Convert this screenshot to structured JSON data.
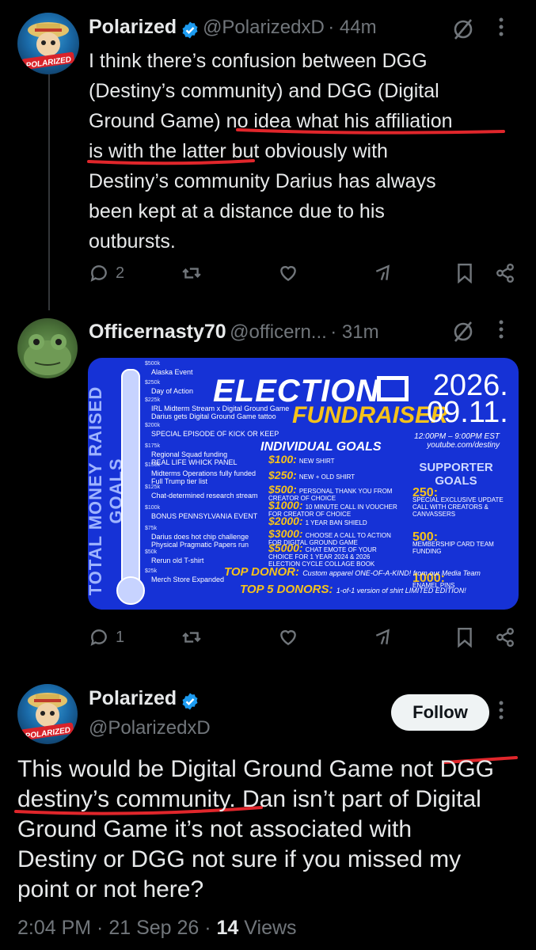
{
  "tweet1": {
    "name": "Polarized",
    "handle": "@PolarizedxD",
    "time": "· 44m",
    "text": "I think there’s confusion between DGG\n(Destiny’s community) and DGG (Digital\nGround Game) no idea what his affiliation\nis with the latter but obviously with\nDestiny’s community Darius has always\nbeen kept at a distance due to his\noutbursts.",
    "replies": "2"
  },
  "tweet2": {
    "name": "Officernasty70",
    "handle": "@officern...",
    "time": "· 31m",
    "replies": "1"
  },
  "poster": {
    "vertical_label": "TOTAL MONEY RAISED GOALS",
    "title": "ELECTION",
    "subtitle": "FUNDRAISER",
    "date_line1": "2026.",
    "date_line2": "09.11.",
    "time": "12:00PM – 9:00PM EST",
    "url": "youtube.com/destiny",
    "individual_heading": "INDIVIDUAL GOALS",
    "supporter_heading": "SUPPORTER GOALS",
    "goals": [
      {
        "amount": "$500k",
        "text": "Alaska Event"
      },
      {
        "amount": "$250k",
        "text": "Day of Action"
      },
      {
        "amount": "$225k",
        "text": "IRL Midterm Stream x Digital Ground Game\nDarius gets Digital Ground Game tattoo"
      },
      {
        "amount": "$200k",
        "text": "SPECIAL EPISODE OF KICK OR KEEP"
      },
      {
        "amount": "$175k",
        "text": "Regional Squad funding\nREAL LIFE WHICK PANEL"
      },
      {
        "amount": "$150k",
        "text": "Midterms Operations fully funded\nFull Trump tier list"
      },
      {
        "amount": "$125k",
        "text": "Chat-determined research stream"
      },
      {
        "amount": "$100k",
        "text": "BONUS PENNSYLVANIA EVENT"
      },
      {
        "amount": "$75k",
        "text": "Darius does hot chip challenge\nPhysical Pragmatic Papers run"
      },
      {
        "amount": "$50k",
        "text": "Rerun old T-shirt"
      },
      {
        "amount": "$25k",
        "text": "Merch Store Expanded"
      }
    ],
    "tiers": [
      {
        "amount": "$100:",
        "text": "NEW SHIRT"
      },
      {
        "amount": "$250:",
        "text": "NEW + OLD SHIRT"
      },
      {
        "amount": "$500:",
        "text": "PERSONAL THANK YOU FROM CREATOR OF CHOICE"
      },
      {
        "amount": "$1000:",
        "text": "10 MINUTE CALL IN VOUCHER FOR CREATOR OF CHOICE"
      },
      {
        "amount": "$2000:",
        "text": "1 YEAR BAN SHIELD"
      },
      {
        "amount": "$3000:",
        "text": "CHOOSE A CALL TO ACTION FOR DIGITAL GROUND GAME"
      },
      {
        "amount": "$5000:",
        "text": "CHAT EMOTE OF YOUR CHOICE FOR 1 YEAR 2024 & 2026 ELECTION CYCLE COLLAGE BOOK"
      }
    ],
    "supporter": [
      {
        "amount": "250:",
        "text": "SPECIAL EXCLUSIVE UPDATE CALL WITH CREATORS & CANVASSERS"
      },
      {
        "amount": "500:",
        "text": "MEMBERSHIP CARD TEAM FUNDING"
      },
      {
        "amount": "1000:",
        "text": "ENAMEL PINS"
      }
    ],
    "top_donor": "TOP DONOR:",
    "top_donor_text": "Custom apparel ONE-OF-A-KIND! from our Media Team",
    "top5": "TOP 5 DONORS:",
    "top5_text": "1-of-1 version of shirt LIMITED EDITION!"
  },
  "tweet3": {
    "name": "Polarized",
    "handle": "@PolarizedxD",
    "follow_label": "Follow",
    "text": "This would be Digital Ground Game not DGG\ndestiny’s community. Dan isn’t part of Digital\nGround Game it’s not associated with\nDestiny or DGG not sure if you missed my\npoint or not here?",
    "time": "2:04 PM · 21 Sep 26 · ",
    "views_count": "14",
    "views_label": " Views"
  },
  "colors": {
    "background": "#000000",
    "text": "#e7e9ea",
    "muted": "#71767b",
    "verified": "#1d9bf0",
    "underline": "#e0262b",
    "poster_blue": "#1632d6",
    "poster_yellow": "#f5c21b"
  },
  "icons": [
    "verified-badge-icon",
    "reply-icon",
    "retweet-icon",
    "like-icon",
    "grok-icon",
    "bookmark-icon",
    "share-icon",
    "grok-logo-icon",
    "more-icon"
  ]
}
